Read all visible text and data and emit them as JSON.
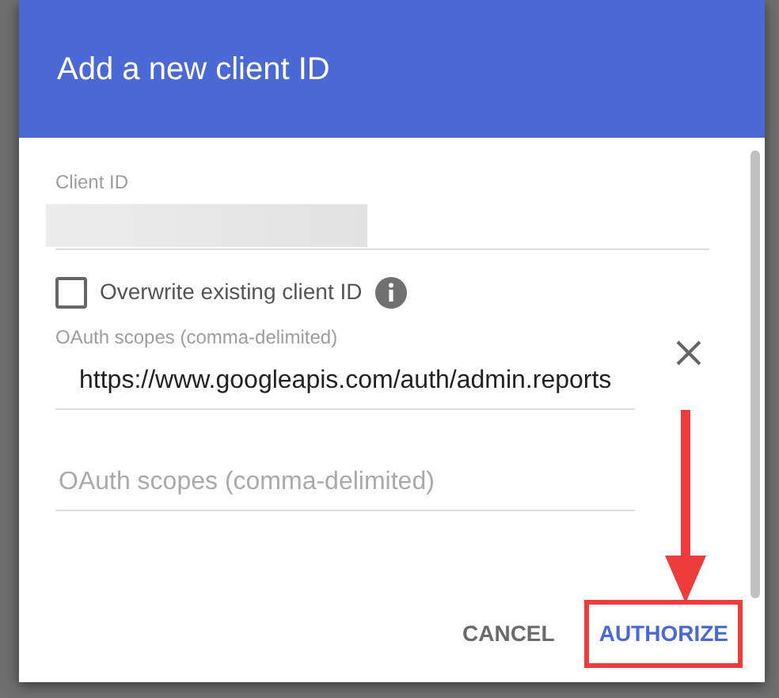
{
  "dialog": {
    "title": "Add a new client ID"
  },
  "client_id": {
    "label": "Client ID"
  },
  "overwrite": {
    "label": "Overwrite existing client ID",
    "checked": false
  },
  "scopes": [
    {
      "label": "OAuth scopes (comma-delimited)",
      "value": "https://www.googleapis.com/auth/admin.reports",
      "removable": true
    },
    {
      "placeholder": "OAuth scopes (comma-delimited)",
      "removable": false
    }
  ],
  "buttons": [
    {
      "label": "CANCEL",
      "kind": "default",
      "highlighted": false
    },
    {
      "label": "AUTHORIZE",
      "kind": "primary",
      "highlighted": true
    }
  ]
}
